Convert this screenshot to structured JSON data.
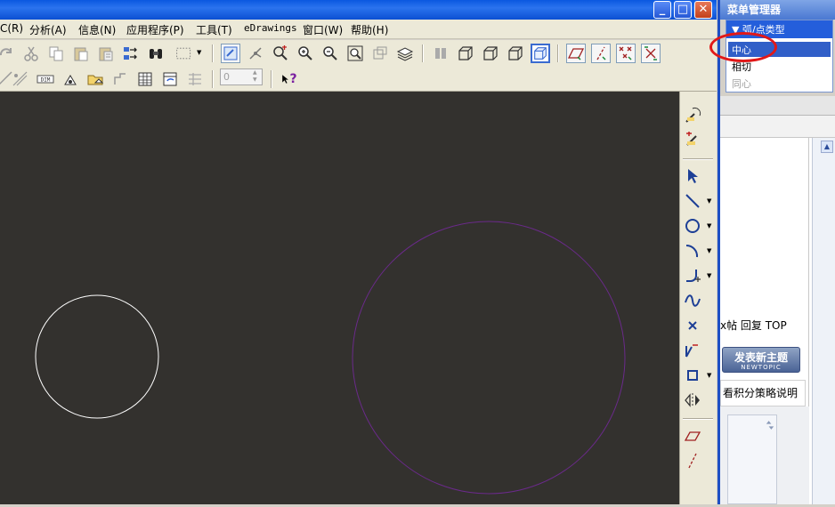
{
  "menubar": {
    "items": [
      "C(R)",
      "分析(A)",
      "信息(N)",
      "应用程序(P)",
      "工具(T)",
      "eDrawings",
      "窗口(W)",
      "帮助(H)"
    ]
  },
  "window": {
    "min_glyph": "_",
    "max_glyph": "□",
    "close_glyph": "✕"
  },
  "toolbar": {
    "spin_value": "0",
    "help_glyph": "?"
  },
  "menu_manager": {
    "title": "菜单管理器",
    "header": "▼ 弧/点类型",
    "options": [
      "中心",
      "相切",
      "同心"
    ],
    "selected": "中心",
    "disabled": "同心"
  },
  "webpage": {
    "links": "x帖  回复  TOP",
    "newtopic_label": "发表新主题",
    "newtopic_sub": "NEWTOPIC",
    "note": "看积分策略说明"
  },
  "sketch": {
    "circles": [
      {
        "name": "small-circle",
        "color": "#ffffff"
      },
      {
        "name": "large-circle",
        "color": "#6a2a8a"
      }
    ]
  },
  "colors": {
    "canvas_bg": "#33312e",
    "title_blue": "#0a58e0",
    "highlight_red": "#e11818"
  }
}
